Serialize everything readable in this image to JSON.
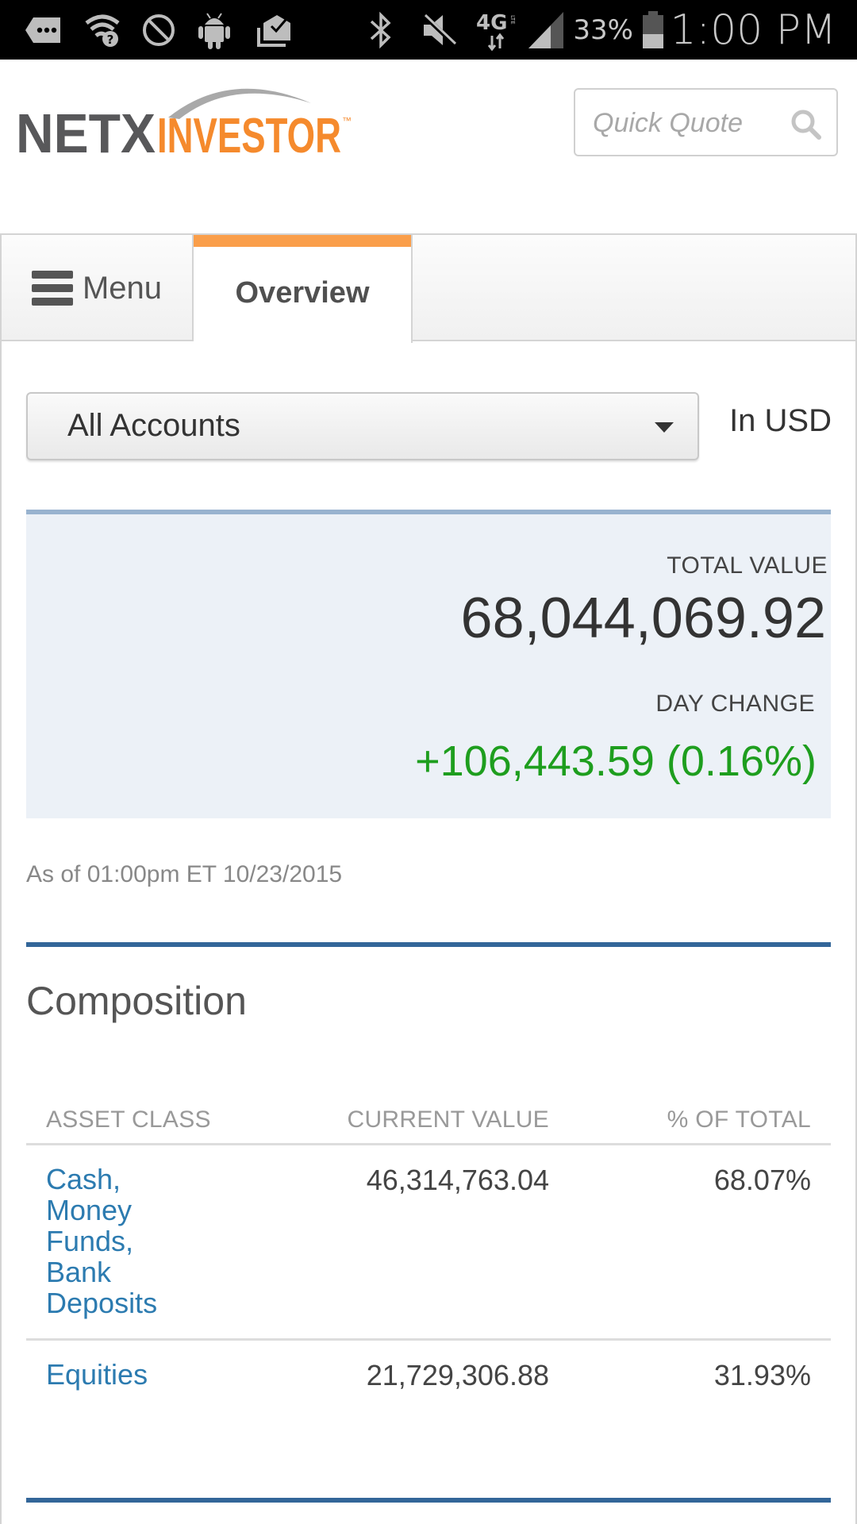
{
  "status_bar": {
    "left_icons": [
      "more-notifications-icon",
      "wifi-unknown-icon",
      "do-not-disturb-icon",
      "android-icon",
      "mail-check-icon"
    ],
    "right_icons": [
      "bluetooth-icon",
      "mute-icon",
      "4g-lte-icon",
      "signal-icon"
    ],
    "battery_percent": "33%",
    "time": "1:00 PM"
  },
  "header": {
    "logo": {
      "part1": "NETX",
      "part2": "INVESTOR",
      "tm": "™"
    },
    "quick_quote": {
      "placeholder": "Quick Quote",
      "value": ""
    }
  },
  "tabs": {
    "menu_label": "Menu",
    "active_label": "Overview"
  },
  "accounts": {
    "selected": "All Accounts",
    "currency": "In USD"
  },
  "summary": {
    "total_label": "TOTAL VALUE",
    "total_value": "68,044,069.92",
    "day_change_label": "DAY CHANGE",
    "day_change_value": "+106,443.59 (0.16%)",
    "as_of": "As of 01:00pm ET 10/23/2015"
  },
  "composition": {
    "title": "Composition",
    "columns": [
      "ASSET CLASS",
      "CURRENT VALUE",
      "% OF TOTAL"
    ],
    "rows": [
      {
        "asset_class": "Cash, Money Funds, Bank Deposits",
        "current_value": "46,314,763.04",
        "pct_of_total": "68.07%"
      },
      {
        "asset_class": "Equities",
        "current_value": "21,729,306.88",
        "pct_of_total": "31.93%"
      }
    ]
  },
  "colors": {
    "brand_orange": "#f58a2d",
    "brand_gray": "#555555",
    "positive_green": "#1e9e1e",
    "link_blue": "#2c7bb0",
    "rule_blue": "#336699"
  }
}
